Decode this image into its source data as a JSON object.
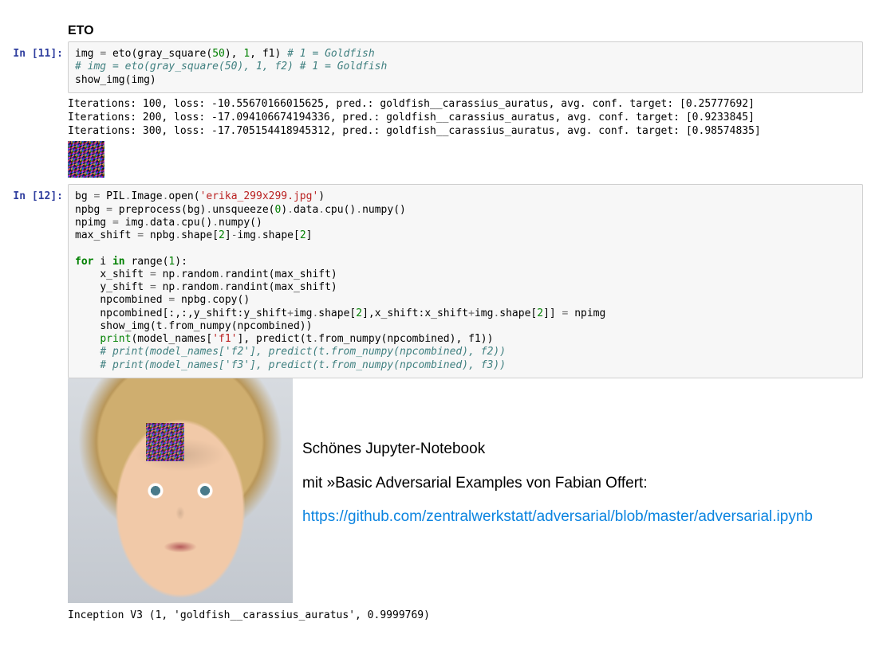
{
  "section": {
    "title": "ETO"
  },
  "cell11": {
    "prompt": "In [11]:",
    "code": {
      "l1a": "img ",
      "l1b": "=",
      "l1c": " eto(gray_square(",
      "l1num": "50",
      "l1d": "), ",
      "l1num2": "1",
      "l1e": ", f1) ",
      "l1comment": "# 1 = Goldfish",
      "l2comment": "# img = eto(gray_square(50), 1, f2) # 1 = Goldfish",
      "l3": "show_img(img)"
    }
  },
  "out11": {
    "line1": "Iterations: 100, loss: -10.55670166015625, pred.: goldfish__carassius_auratus, avg. conf. target: [0.25777692]",
    "line2": "Iterations: 200, loss: -17.094106674194336, pred.: goldfish__carassius_auratus, avg. conf. target: [0.9233845]",
    "line3": "Iterations: 300, loss: -17.705154418945312, pred.: goldfish__carassius_auratus, avg. conf. target: [0.98574835]"
  },
  "cell12": {
    "prompt": "In [12]:",
    "code": {
      "bg_a": "bg ",
      "eq": "=",
      "bg_b": " PIL",
      "dot": ".",
      "bg_c": "Image",
      "bg_d": "open(",
      "bg_str": "'erika_299x299.jpg'",
      "bg_e": ")",
      "npbg": "npbg ",
      "npbg_b": " preprocess(bg)",
      "npbg_c": "unsqueeze(",
      "zero": "0",
      "npbg_d": ")",
      "npbg_e": "data",
      "npbg_f": "cpu()",
      "npbg_g": "numpy()",
      "npimg": "npimg ",
      "npimg_b": " img",
      "npimg_c": "data",
      "npimg_d": "cpu()",
      "npimg_e": "numpy()",
      "max_a": "max_shift ",
      "max_b": " npbg",
      "max_c": "shape[",
      "two": "2",
      "max_d": "]",
      "minus": "-",
      "max_e": "img",
      "max_f": "shape[",
      "for": "for",
      "in": "in",
      "range": " range(",
      "one": "1",
      "paren_close": "):",
      "ind": "    ",
      "xs_a": "x_shift ",
      "xs_b": " np",
      "xs_c": "random",
      "xs_d": "randint(max_shift)",
      "ys_a": "y_shift ",
      "nc_a": "npcombined ",
      "nc_b": " npbg",
      "nc_c": "copy()",
      "nci_a": "npcombined[:,:,y_shift:y_shift",
      "plus": "+",
      "nci_b": "img",
      "nci_c": "shape[",
      "nci_d": "],x_shift:x_shift",
      "nci_e": "]] ",
      "nci_f": " npimg",
      "show_a": "show_img(t",
      "show_b": "from_numpy(npcombined))",
      "print": "print",
      "pr_a": "(model_names[",
      "pr_str": "'f1'",
      "pr_b": "], predict(t",
      "pr_c": "from_numpy(npcombined), f1))",
      "cmt2": "# print(model_names['f2'], predict(t.from_numpy(npcombined), f2))",
      "cmt3": "# print(model_names['f3'], predict(t.from_numpy(npcombined), f3))"
    }
  },
  "side": {
    "line1": "Schönes Jupyter-Notebook",
    "line2": "mit »Basic Adversarial Examples von Fabian Offert:",
    "link": "https://github.com/zentralwerkstatt/adversarial/blob/master/adversarial.ipynb"
  },
  "out12_final": "Inception V3 (1, 'goldfish__carassius_auratus', 0.9999769)"
}
